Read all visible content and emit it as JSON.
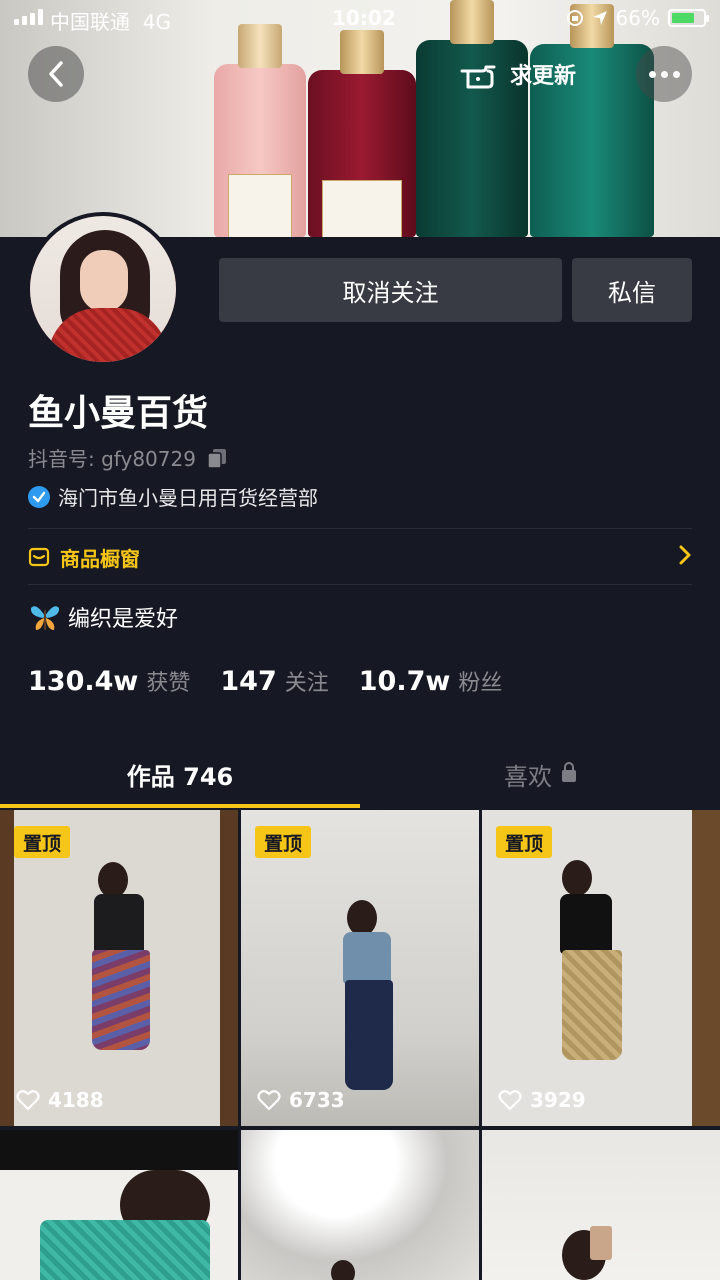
{
  "status_bar": {
    "carrier": "中国联通",
    "network": "4G",
    "time": "10:02",
    "battery": "66%"
  },
  "header": {
    "update_label": "求更新"
  },
  "profile": {
    "follow_button": "取消关注",
    "message_button": "私信",
    "name": "鱼小曼百货",
    "douyin_id": "抖音号: gfy80729",
    "verified_text": "海门市鱼小曼日用百货经营部",
    "shop_label": "商品橱窗",
    "bio": "编织是爱好",
    "stats": [
      {
        "num": "130.4w",
        "unit": "获赞"
      },
      {
        "num": "147",
        "unit": "关注"
      },
      {
        "num": "10.7w",
        "unit": "粉丝"
      }
    ]
  },
  "tabs": {
    "works": "作品 746",
    "likes": "喜欢"
  },
  "grid": {
    "pin_label": "置顶",
    "videos": [
      {
        "likes": "4188"
      },
      {
        "likes": "6733"
      },
      {
        "likes": "3929"
      }
    ]
  },
  "colors": {
    "background": "#161823",
    "accent": "#f5c518",
    "button": "#393b44",
    "verified": "#2f9bf0"
  }
}
